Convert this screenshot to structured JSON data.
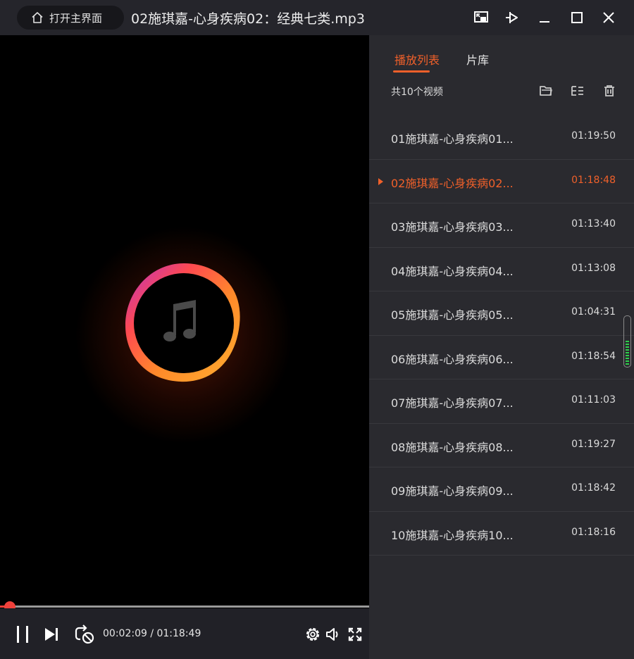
{
  "titlebar": {
    "home_button": "打开主界面",
    "title": "02施琪嘉-心身疾病02：经典七类.mp3",
    "controls": [
      "mini-mode-icon",
      "pin-icon",
      "minimize-icon",
      "maximize-icon",
      "close-icon"
    ]
  },
  "player": {
    "artwork_icon": "music-note-icon",
    "progress_fraction": 0.027,
    "current_time": "00:02:09",
    "total_time": "01:18:49",
    "time_display": "00:02:09 / 01:18:49",
    "controls": {
      "left": [
        "pause-icon",
        "next-icon",
        "loop-mode-icon"
      ],
      "right": [
        "settings-icon",
        "volume-icon",
        "fullscreen-icon"
      ]
    }
  },
  "sidebar": {
    "tabs": [
      {
        "label": "播放列表",
        "active": true
      },
      {
        "label": "片库",
        "active": false
      }
    ],
    "count_label": "共10个视频",
    "tools": [
      "open-folder-icon",
      "add-list-icon",
      "trash-icon"
    ],
    "active_index": 1,
    "items": [
      {
        "name": "01施琪嘉-心身疾病01...",
        "duration": "01:19:50"
      },
      {
        "name": "02施琪嘉-心身疾病02...",
        "duration": "01:18:48"
      },
      {
        "name": "03施琪嘉-心身疾病03...",
        "duration": "01:13:40"
      },
      {
        "name": "04施琪嘉-心身疾病04...",
        "duration": "01:13:08"
      },
      {
        "name": "05施琪嘉-心身疾病05...",
        "duration": "01:04:31"
      },
      {
        "name": "06施琪嘉-心身疾病06...",
        "duration": "01:18:54"
      },
      {
        "name": "07施琪嘉-心身疾病07...",
        "duration": "01:11:03"
      },
      {
        "name": "08施琪嘉-心身疾病08...",
        "duration": "01:19:27"
      },
      {
        "name": "09施琪嘉-心身疾病09...",
        "duration": "01:18:42"
      },
      {
        "name": "10施琪嘉-心身疾病10...",
        "duration": "01:18:16"
      }
    ]
  },
  "colors": {
    "accent": "#f0602a",
    "progress": "#e8413a",
    "titlebar_bg": "#25252b",
    "sidebar_bg": "#2a2a2f",
    "controls_bg": "#212127"
  }
}
